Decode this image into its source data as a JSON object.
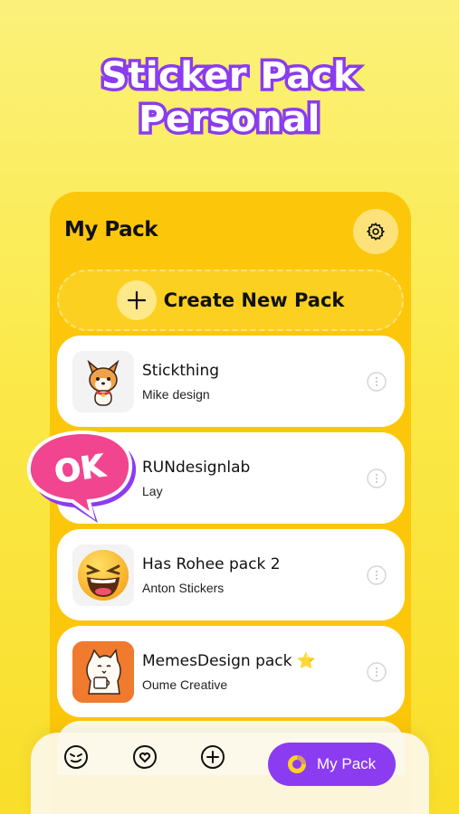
{
  "headline": {
    "line1": "Sticker Pack",
    "line2": "Personal"
  },
  "card": {
    "title": "My Pack",
    "settings_icon": "gear-icon"
  },
  "create": {
    "label": "Create New Pack",
    "icon": "plus-icon"
  },
  "packs": [
    {
      "name": "Stickthing",
      "author": "Mike design",
      "thumb": "corgi-sticker"
    },
    {
      "name": "RUNdesignlab",
      "author": "Lay",
      "thumb": "ok-bubble-sticker"
    },
    {
      "name": "Has Rohee pack 2",
      "author": "Anton Stickers",
      "thumb": "laughing-emoji"
    },
    {
      "name": "MemesDesign pack ⭐",
      "author": "Oume Creative",
      "thumb": "cat-meme"
    }
  ],
  "ok_badge": {
    "text": "OK"
  },
  "nav": {
    "items": [
      {
        "icon": "emoji-face-icon"
      },
      {
        "icon": "heart-chat-icon"
      },
      {
        "icon": "add-circle-icon"
      }
    ],
    "active_label": "My Pack",
    "colors": {
      "accent": "#8b3cf1",
      "card": "#fcc70a"
    }
  }
}
